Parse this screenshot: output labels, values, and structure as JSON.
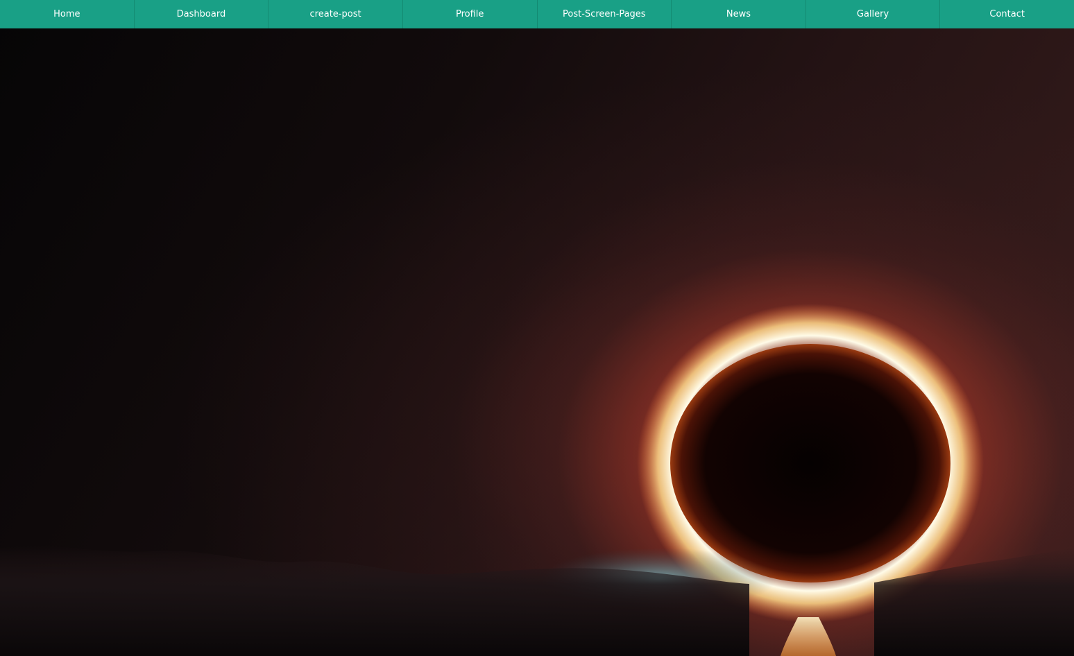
{
  "nav": {
    "items": [
      {
        "label": "Home"
      },
      {
        "label": "Dashboard"
      },
      {
        "label": "create-post"
      },
      {
        "label": "Profile"
      },
      {
        "label": "Post-Screen-Pages"
      },
      {
        "label": "News"
      },
      {
        "label": "Gallery"
      },
      {
        "label": "Contact"
      }
    ]
  },
  "colors": {
    "navbar": "#19a086",
    "nav_text": "#ffffff",
    "corona": "#fff6d8",
    "glow": "#e2552e"
  },
  "hero": {
    "image": "solar-eclipse-photo"
  }
}
